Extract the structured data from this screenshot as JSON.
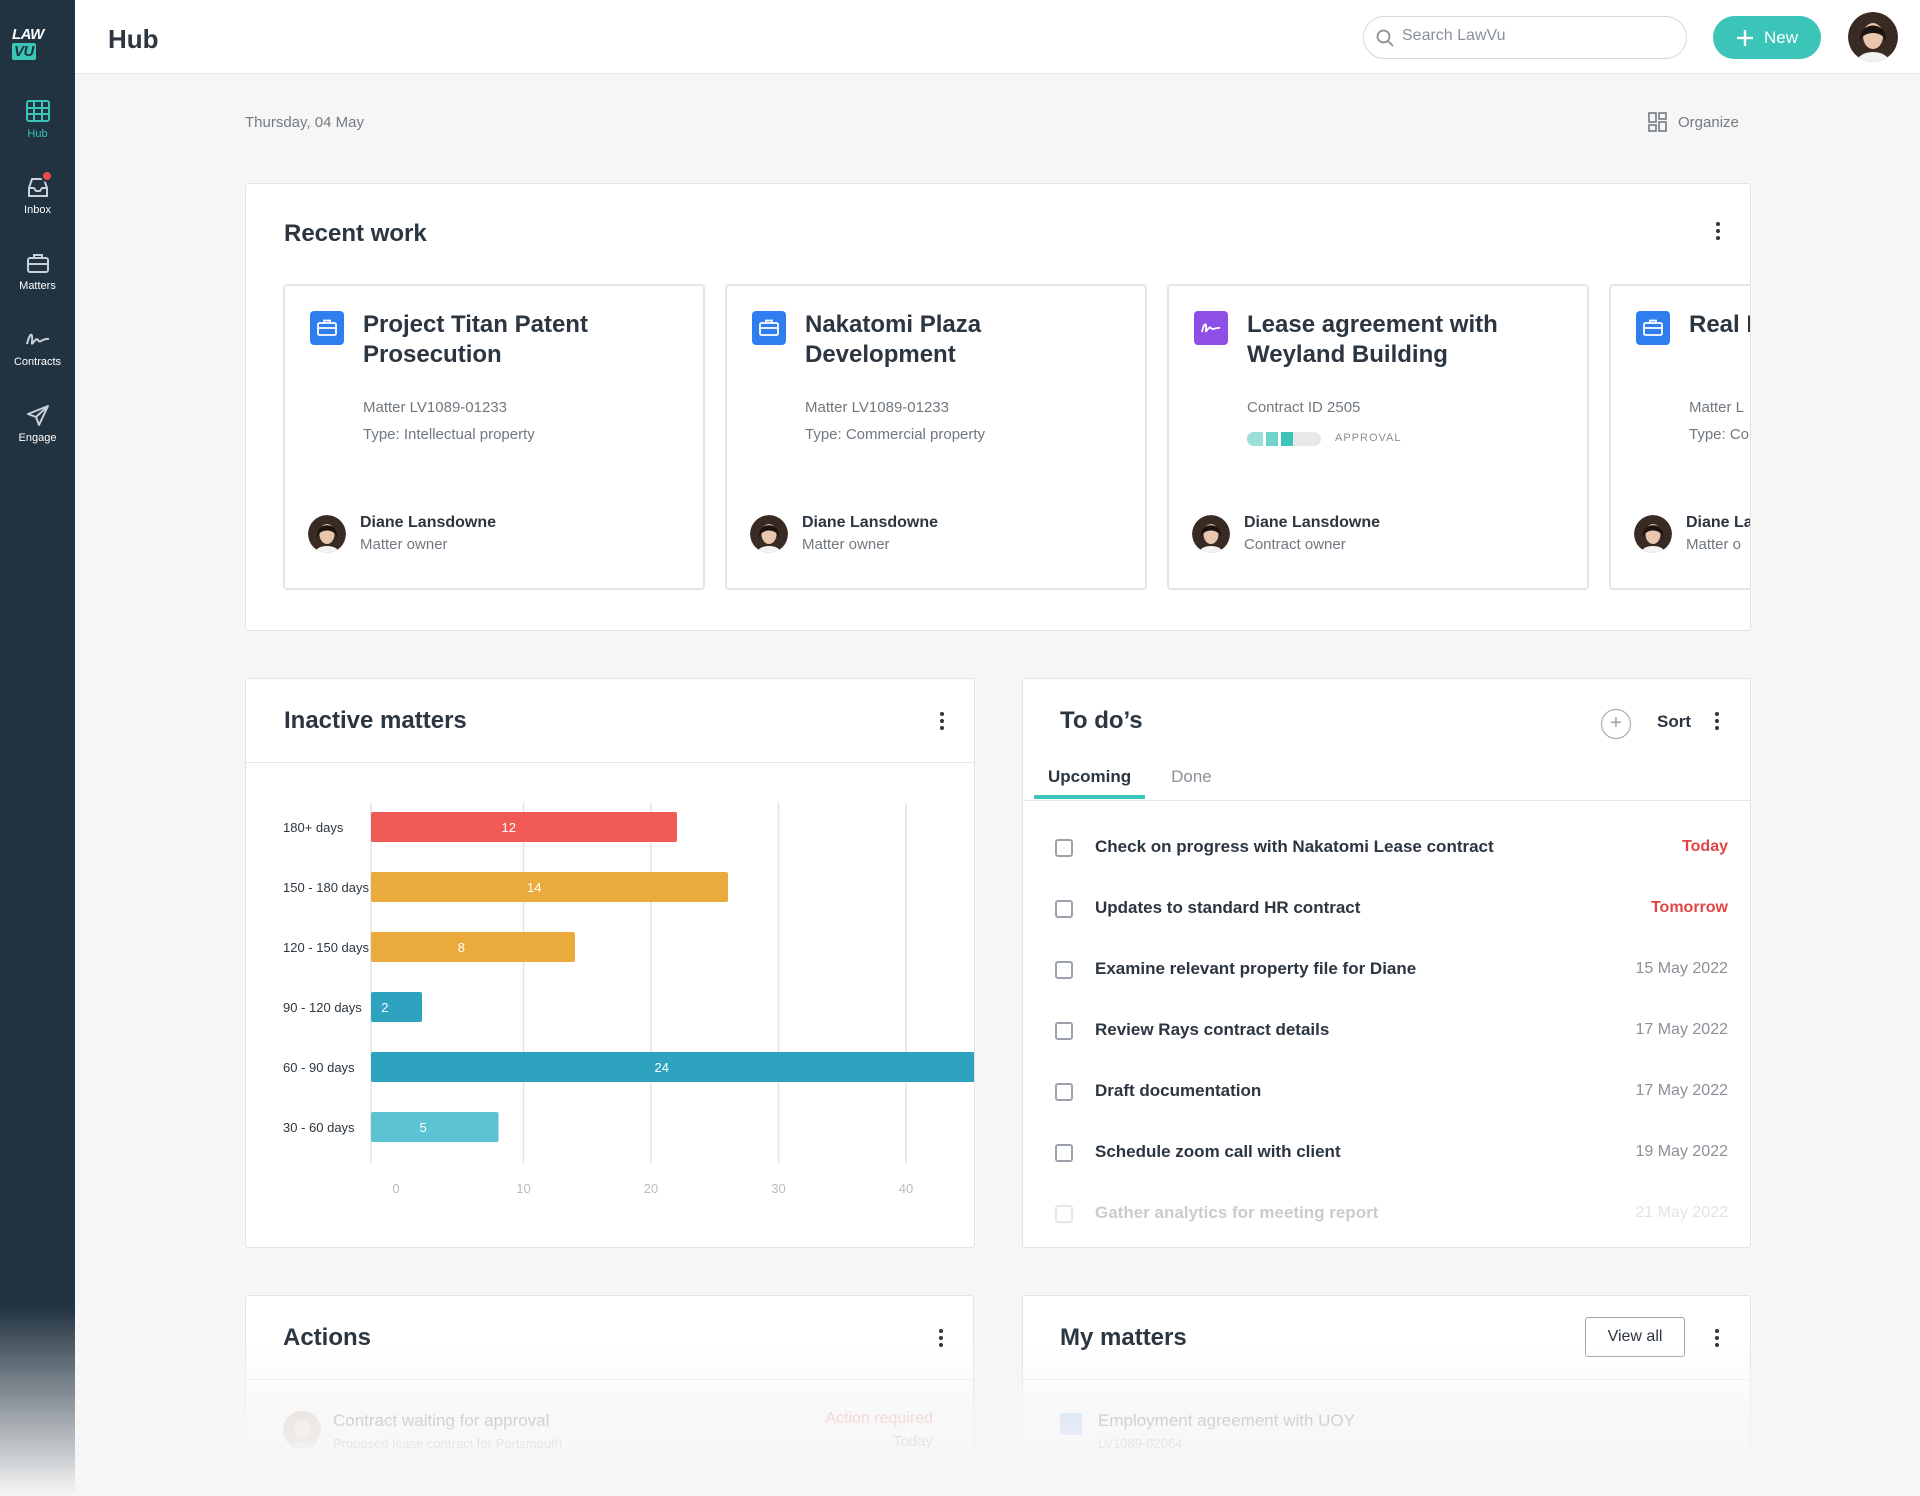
{
  "app": {
    "logo_a": "LAW",
    "logo_b": "VU",
    "page_title": "Hub"
  },
  "sidebar": {
    "items": [
      {
        "label": "Hub",
        "icon": "grid-icon",
        "active": true
      },
      {
        "label": "Inbox",
        "icon": "inbox-icon",
        "badge": true
      },
      {
        "label": "Matters",
        "icon": "briefcase-icon"
      },
      {
        "label": "Contracts",
        "icon": "signature-icon"
      },
      {
        "label": "Engage",
        "icon": "paper-plane-icon"
      }
    ]
  },
  "header": {
    "search_placeholder": "Search LawVu",
    "new_label": "New"
  },
  "dashboard": {
    "date": "Thursday, 04 May",
    "organize_label": "Organize"
  },
  "recent_work": {
    "title": "Recent work",
    "items": [
      {
        "title": "Project Titan Patent Prosecution",
        "line1": "Matter LV1089-01233",
        "line2": "Type:  Intellectual property",
        "owner": "Diane Lansdowne",
        "role": "Matter owner",
        "icon": "briefcase-icon"
      },
      {
        "title": "Nakatomi Plaza Development",
        "line1": "Matter LV1089-01233",
        "line2": "Type:  Commercial property",
        "owner": "Diane Lansdowne",
        "role": "Matter owner",
        "icon": "briefcase-icon"
      },
      {
        "title": "Lease agreement with Weyland Building",
        "line1": "Contract ID 2505",
        "status": "APPROVAL",
        "owner": "Diane Lansdowne",
        "role": "Contract owner",
        "icon": "signature-icon",
        "progress": 0.5
      },
      {
        "title": "Real E",
        "line1": "Matter L",
        "line2": "Type:  Co",
        "owner": "Diane La",
        "role": "Matter o",
        "icon": "briefcase-icon"
      }
    ]
  },
  "inactive_matters": {
    "title": "Inactive matters"
  },
  "chart_data": {
    "type": "bar",
    "orientation": "horizontal",
    "categories": [
      "180+ days",
      "150 - 180 days",
      "120 - 150 days",
      "90 - 120 days",
      "60 - 90 days",
      "30 - 60 days"
    ],
    "values": [
      12,
      14,
      8,
      2,
      24,
      5
    ],
    "colors": [
      "#ef5a57",
      "#ebaa3c",
      "#ebaa3c",
      "#2ea3c0",
      "#2ea3c0",
      "#5cc3d4"
    ],
    "xlim": [
      0,
      40
    ],
    "xticks": [
      0,
      10,
      20,
      30,
      40
    ],
    "grid": true,
    "data_labels": true
  },
  "todos": {
    "title": "To do’s",
    "sort_label": "Sort",
    "tabs": [
      "Upcoming",
      "Done"
    ],
    "items": [
      {
        "text": "Check on progress with Nakatomi Lease contract",
        "due": "Today",
        "urgent": true
      },
      {
        "text": "Updates to standard HR contract",
        "due": "Tomorrow",
        "urgent": true
      },
      {
        "text": "Examine relevant property file for Diane",
        "due": "15 May 2022"
      },
      {
        "text": "Review Rays contract details",
        "due": "17 May 2022"
      },
      {
        "text": "Draft documentation",
        "due": "17 May 2022"
      },
      {
        "text": "Schedule zoom call with client",
        "due": "19 May 2022"
      },
      {
        "text": "Gather analytics for meeting report",
        "due": "21 May 2022",
        "faded": true
      }
    ]
  },
  "actions": {
    "title": "Actions",
    "row_title": "Contract waiting for approval",
    "row_sub": "Proposed lease contract for Portsmouth",
    "status": "Action required",
    "when": "Today"
  },
  "my_matters": {
    "title": "My matters",
    "view_all": "View all",
    "row_title": "Employment agreement with UOY",
    "row_sub": "LV1089-02064"
  },
  "colors": {
    "accent": "#3bc4b8",
    "sidebar": "#213240",
    "urgent": "#e14545",
    "briefcase": "#2f7ef0",
    "contract": "#8d4fe6"
  }
}
